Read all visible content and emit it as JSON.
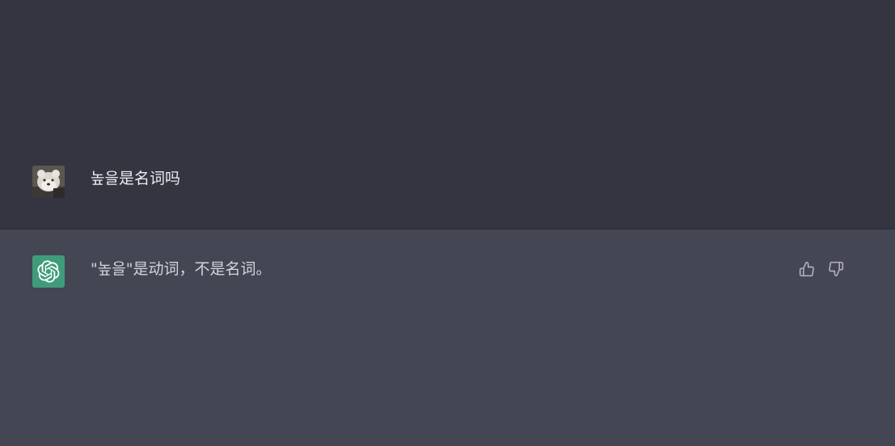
{
  "conversation": {
    "user_message": {
      "avatar_icon": "user-photo-avatar",
      "text": "높을是名词吗"
    },
    "assistant_message": {
      "avatar_icon": "openai-logo-icon",
      "text": "\"높을\"是动词，不是名词。"
    },
    "feedback": {
      "thumbs_up_icon": "thumbs-up-icon",
      "thumbs_down_icon": "thumbs-down-icon"
    }
  },
  "colors": {
    "user_bg": "#343541",
    "assistant_bg": "#444654",
    "gpt_avatar": "#3f9c7b",
    "text": "#ececf1",
    "icon": "#acacbe"
  }
}
